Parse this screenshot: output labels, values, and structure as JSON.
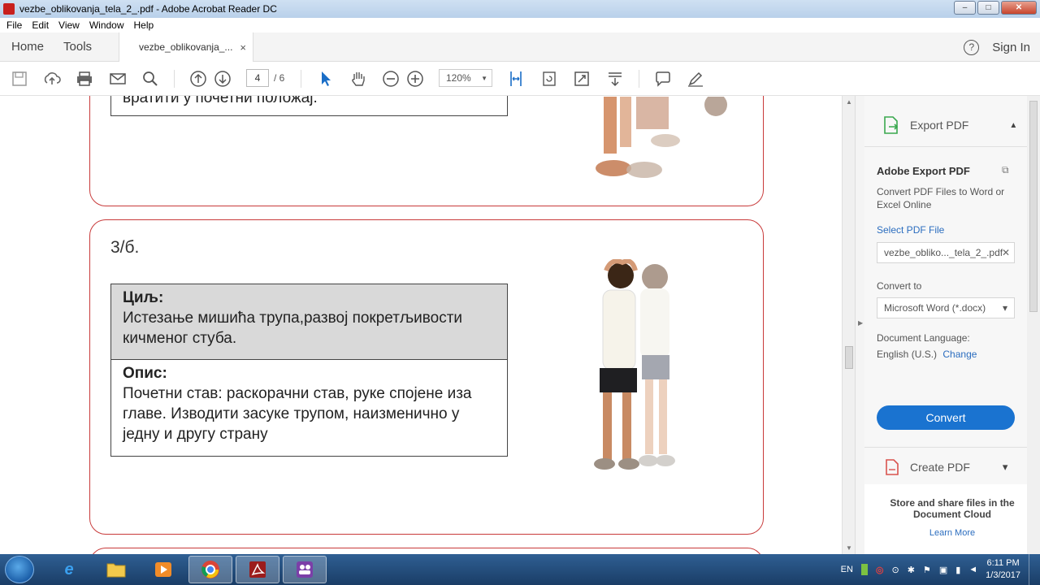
{
  "window": {
    "title": "vezbe_oblikovanja_tela_2_.pdf - Adobe Acrobat Reader DC",
    "minimize": "‒",
    "maximize": "□",
    "close": "✕"
  },
  "menu": [
    "File",
    "Edit",
    "View",
    "Window",
    "Help"
  ],
  "tabs": {
    "home": "Home",
    "tools": "Tools",
    "document": "vezbe_oblikovanja_...",
    "close": "×",
    "help": "?",
    "sign_in": "Sign In"
  },
  "toolbar": {
    "page_current": "4",
    "page_total": "/ 6",
    "zoom": "120%",
    "zoom_caret": "▼",
    "icons": [
      "save-icon",
      "upload-icon",
      "print-icon",
      "mail-icon",
      "search-icon",
      "page-up-icon",
      "page-down-icon",
      "select-cursor-icon",
      "hand-icon",
      "zoom-out-icon",
      "zoom-in-icon",
      "fit-width-icon",
      "rotate-icon",
      "full-screen-icon",
      "read-mode-icon",
      "comment-icon",
      "sign-icon"
    ]
  },
  "document": {
    "top_card_text": "провући руке што више кроз ноге, а затим се вратити у почетни положај.",
    "card": {
      "number": "3/б.",
      "goal_heading": "Циљ:",
      "goal_text": "Истезање мишића трупа,развој покретљивости кичменог стуба.",
      "desc_heading": "Опис:",
      "desc_text": "Почетни став: раскорачни став, руке спојене иза главе. Изводити засуке трупом, наизменично у једну и другу страну"
    }
  },
  "right_panel": {
    "export_title": "Export PDF",
    "export_caret": "▲",
    "adobe_export": "Adobe Export PDF",
    "description": "Convert PDF Files to Word or Excel Online",
    "select_label": "Select PDF File",
    "file_name": "vezbe_obliko..._tela_2_.pdf",
    "file_clear": "✕",
    "convert_to_label": "Convert to",
    "convert_to_value": "Microsoft Word (*.docx)",
    "convert_caret": "▾",
    "doc_language_label": "Document Language:",
    "doc_language_value": "English (U.S.)",
    "change": "Change",
    "convert_button": "Convert",
    "create_pdf": "Create PDF",
    "create_caret": "▾",
    "store_text": "Store and share files in the Document Cloud",
    "learn_more": "Learn More"
  },
  "taskbar": {
    "language": "EN",
    "time": "6:11 PM",
    "date": "1/3/2017",
    "apps": [
      "ie-icon",
      "explorer-icon",
      "media-player-icon",
      "chrome-icon",
      "acrobat-icon",
      "teams-icon"
    ]
  },
  "colors": {
    "card_border": "#c83a3a",
    "accent_blue": "#1a73d0",
    "export_green": "#3aa84f",
    "create_red": "#d9534f"
  }
}
